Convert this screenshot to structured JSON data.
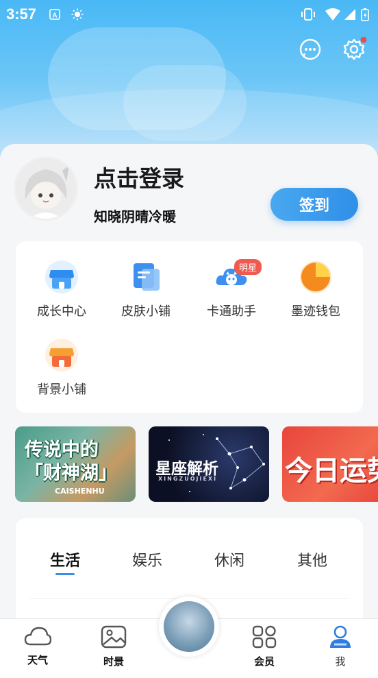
{
  "status_bar": {
    "time": "3:57"
  },
  "profile": {
    "login_title": "点击登录",
    "subtitle": "知晓阴晴冷暖",
    "signin_label": "签到"
  },
  "grid": {
    "items": [
      {
        "label": "成长中心",
        "icon": "store-icon",
        "color": "#2e8ef0"
      },
      {
        "label": "皮肤小铺",
        "icon": "document-icon",
        "color": "#3d8ff0"
      },
      {
        "label": "卡通助手",
        "icon": "cartoon-cloud-icon",
        "color": "#3d8ff0"
      },
      {
        "label": "墨迹钱包",
        "icon": "wallet-pie-icon",
        "color": "#f59a23"
      },
      {
        "label": "背景小铺",
        "icon": "shop-icon",
        "color": "#f5a031"
      }
    ],
    "badge": "明星"
  },
  "banners": [
    {
      "title": "传说中的「财神湖」",
      "subtitle": "CAISHENHU"
    },
    {
      "title": "星座解析",
      "subtitle": "XINGZUOJIEXI"
    },
    {
      "title": "今日运势"
    }
  ],
  "tabs": [
    {
      "label": "生活",
      "active": true
    },
    {
      "label": "娱乐"
    },
    {
      "label": "休闲"
    },
    {
      "label": "其他"
    }
  ],
  "navbar": {
    "items": [
      {
        "label": "天气"
      },
      {
        "label": "时景"
      },
      {
        "label": "会员"
      },
      {
        "label": "我"
      }
    ]
  }
}
